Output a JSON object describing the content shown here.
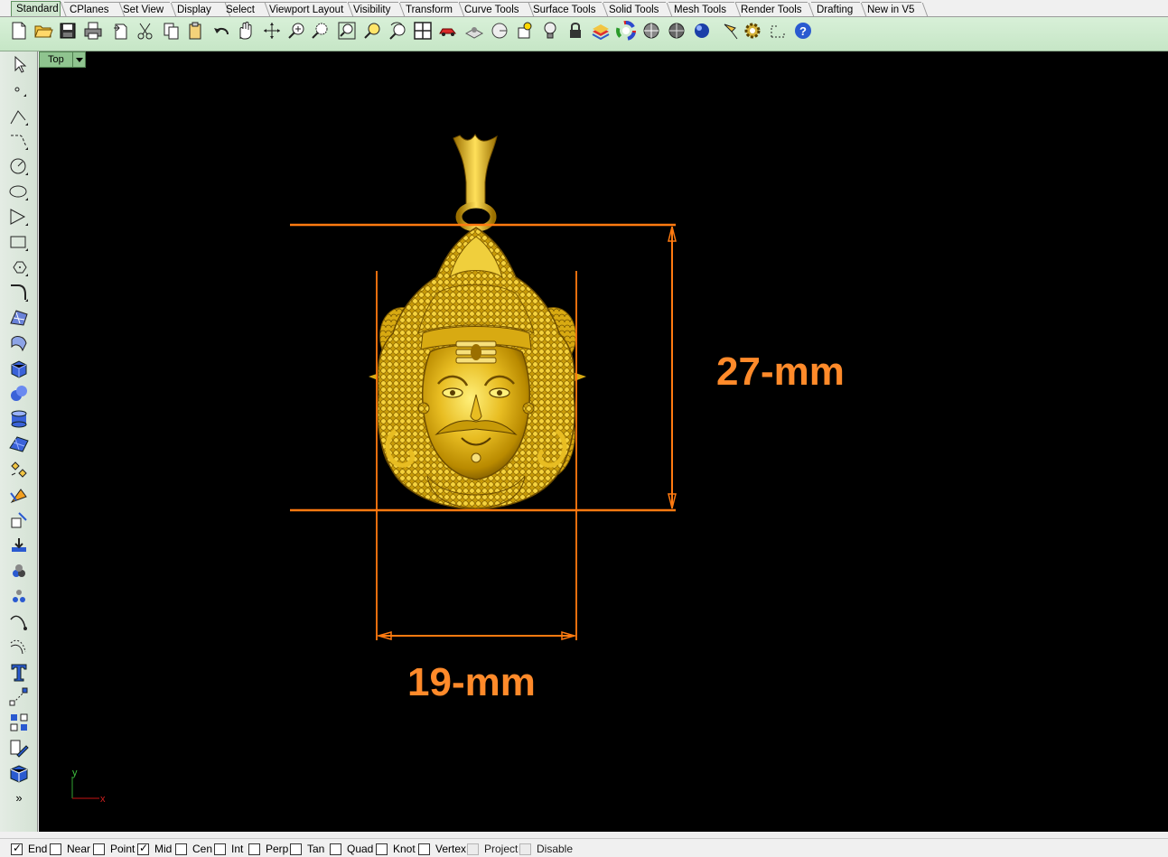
{
  "tabs": [
    "Standard",
    "CPlanes",
    "Set View",
    "Display",
    "Select",
    "Viewport Layout",
    "Visibility",
    "Transform",
    "Curve Tools",
    "Surface Tools",
    "Solid Tools",
    "Mesh Tools",
    "Render Tools",
    "Drafting",
    "New in V5"
  ],
  "active_tab": "Standard",
  "viewport": {
    "name": "Top",
    "axis_x_label": "x",
    "axis_y_label": "y"
  },
  "dimensions": {
    "height_label": "27-mm",
    "width_label": "19-mm"
  },
  "osnaps": [
    {
      "label": "End",
      "checked": true,
      "enabled": true
    },
    {
      "label": "Near",
      "checked": false,
      "enabled": true
    },
    {
      "label": "Point",
      "checked": false,
      "enabled": true
    },
    {
      "label": "Mid",
      "checked": true,
      "enabled": true
    },
    {
      "label": "Cen",
      "checked": false,
      "enabled": true
    },
    {
      "label": "Int",
      "checked": false,
      "enabled": true
    },
    {
      "label": "Perp",
      "checked": false,
      "enabled": true
    },
    {
      "label": "Tan",
      "checked": false,
      "enabled": true
    },
    {
      "label": "Quad",
      "checked": false,
      "enabled": true
    },
    {
      "label": "Knot",
      "checked": false,
      "enabled": true
    },
    {
      "label": "Vertex",
      "checked": false,
      "enabled": true
    },
    {
      "label": "Project",
      "checked": false,
      "enabled": false
    },
    {
      "label": "Disable",
      "checked": false,
      "enabled": false
    }
  ],
  "toolbar_icons": [
    "new-file-icon",
    "open-file-icon",
    "save-icon",
    "print-icon",
    "import-icon",
    "cut-icon",
    "copy-icon",
    "paste-icon",
    "undo-icon",
    "pan-icon",
    "rotate-view-icon",
    "zoom-icon",
    "zoom-window-icon",
    "zoom-extents-icon",
    "zoom-selected-icon",
    "undo-view-icon",
    "four-viewports-icon",
    "car-icon",
    "cplane-icon",
    "object-snap-icon",
    "properties-icon",
    "light-bulb-icon",
    "lock-icon",
    "layer-icon",
    "color-wheel-icon",
    "shaded-sphere-icon",
    "rendered-sphere-icon",
    "blue-sphere-icon",
    "pencil-icon",
    "gear-icon",
    "gumball-icon",
    "help-icon"
  ],
  "left_icons": [
    "select-arrow-icon",
    "point-icon",
    "polyline-icon",
    "curve-icon",
    "circle-icon",
    "ellipse-icon",
    "arc-icon",
    "rectangle-icon",
    "polygon-icon",
    "fillet-curve-icon",
    "surface-from-points-icon",
    "extrude-icon",
    "box-icon",
    "boolean-union-icon",
    "cylinder-icon",
    "mesh-plane-icon",
    "explode-icon",
    "move-icon",
    "transform-icon",
    "array-icon",
    "group-icon",
    "point-cloud-icon",
    "curve-from-object-icon",
    "offset-curve-icon",
    "text-icon",
    "dimension-icon",
    "block-icon",
    "edit-icon",
    "box-3d-icon",
    "more-icon"
  ]
}
